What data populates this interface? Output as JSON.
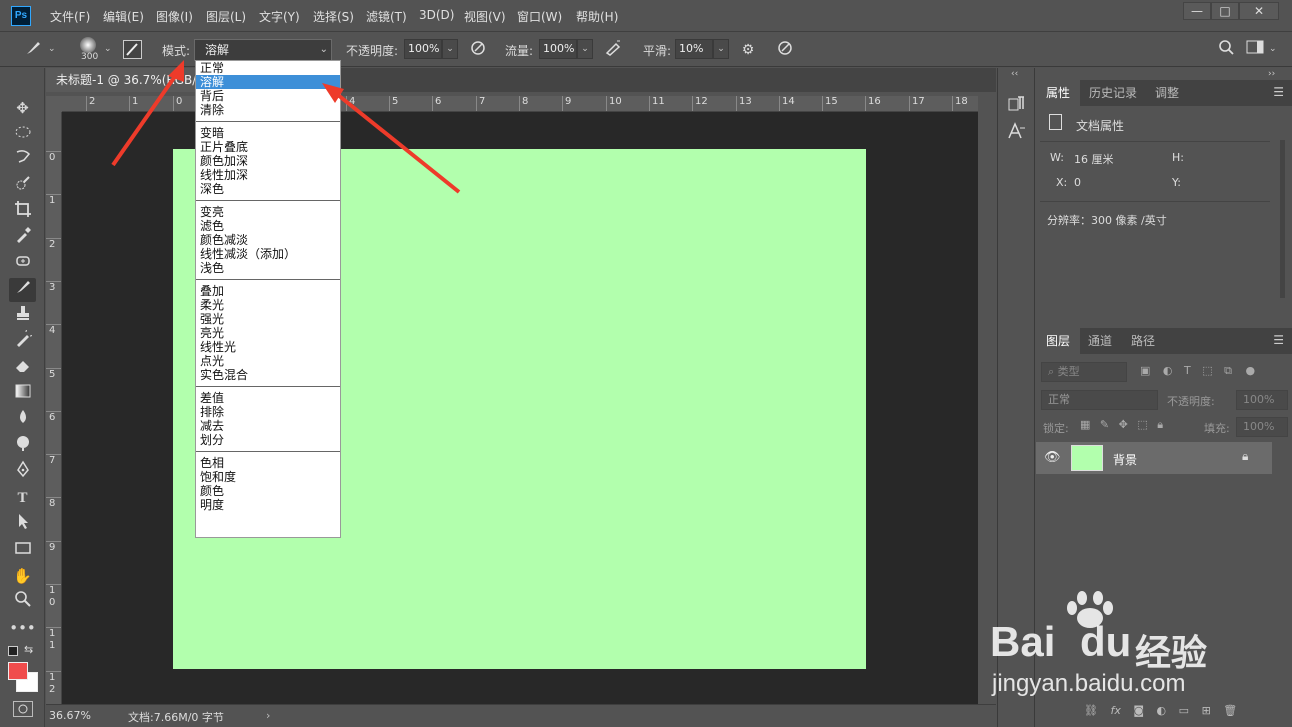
{
  "menubar": {
    "logo": "Ps",
    "items": [
      "文件(F)",
      "编辑(E)",
      "图像(I)",
      "图层(L)",
      "文字(Y)",
      "选择(S)",
      "滤镜(T)",
      "3D(D)",
      "视图(V)",
      "窗口(W)",
      "帮助(H)"
    ],
    "window_buttons": [
      "—",
      "□",
      "✕"
    ]
  },
  "options": {
    "brush_size": "300",
    "mode_label": "模式:",
    "mode_value": "溶解",
    "opacity_label": "不透明度:",
    "opacity_value": "100%",
    "flow_label": "流量:",
    "flow_value": "100%",
    "smooth_label": "平滑:",
    "smooth_value": "10%"
  },
  "document": {
    "tab_title": "未标题-1 @ 36.7%(RGB/8)",
    "canvas_color": "#b2ffad",
    "ruler_h": [
      "2",
      "1",
      "0",
      "1",
      "2",
      "3",
      "4",
      "5",
      "6",
      "7",
      "8",
      "9",
      "10",
      "11",
      "12",
      "13",
      "14",
      "15",
      "16",
      "17",
      "18"
    ],
    "ruler_v": [
      "0",
      "1",
      "2",
      "3",
      "4",
      "5",
      "6",
      "7",
      "8",
      "9",
      "1 0",
      "1 1",
      "1 2"
    ],
    "zoom": "36.67%",
    "doc_info": "文档:7.66M/0 字节"
  },
  "blend_menu": {
    "groups": [
      [
        "正常",
        "溶解",
        "背后",
        "清除"
      ],
      [
        "变暗",
        "正片叠底",
        "颜色加深",
        "线性加深",
        "深色"
      ],
      [
        "变亮",
        "滤色",
        "颜色减淡",
        "线性减淡（添加）",
        "浅色"
      ],
      [
        "叠加",
        "柔光",
        "强光",
        "亮光",
        "线性光",
        "点光",
        "实色混合"
      ],
      [
        "差值",
        "排除",
        "减去",
        "划分"
      ],
      [
        "色相",
        "饱和度",
        "颜色",
        "明度"
      ]
    ],
    "selected": "溶解"
  },
  "properties_panel": {
    "tabs": [
      "属性",
      "历史记录",
      "调整"
    ],
    "heading": "文档属性",
    "w_label": "W:",
    "w_value": "16 厘米",
    "h_label": "H:",
    "x_label": "X:",
    "x_value": "0",
    "y_label": "Y:",
    "resolution": "分辨率：300 像素 /英寸"
  },
  "layers_panel": {
    "tabs": [
      "图层",
      "通道",
      "路径"
    ],
    "filter_placeholder": "类型",
    "blend_mode": "正常",
    "opacity_label": "不透明度:",
    "opacity_value": "100%",
    "lock_label": "锁定:",
    "fill_label": "填充:",
    "fill_value": "100%",
    "layer_name": "背景",
    "bottom_icons": [
      "GO",
      "fx"
    ]
  },
  "colors": {
    "foreground": "#f04c4c",
    "background": "#ffffff",
    "arrow": "#ee3b2a"
  },
  "watermark": {
    "brand_latin": "Bai",
    "brand_latin2": "du",
    "brand_cn": "经验",
    "url": "jingyan.baidu.com"
  }
}
